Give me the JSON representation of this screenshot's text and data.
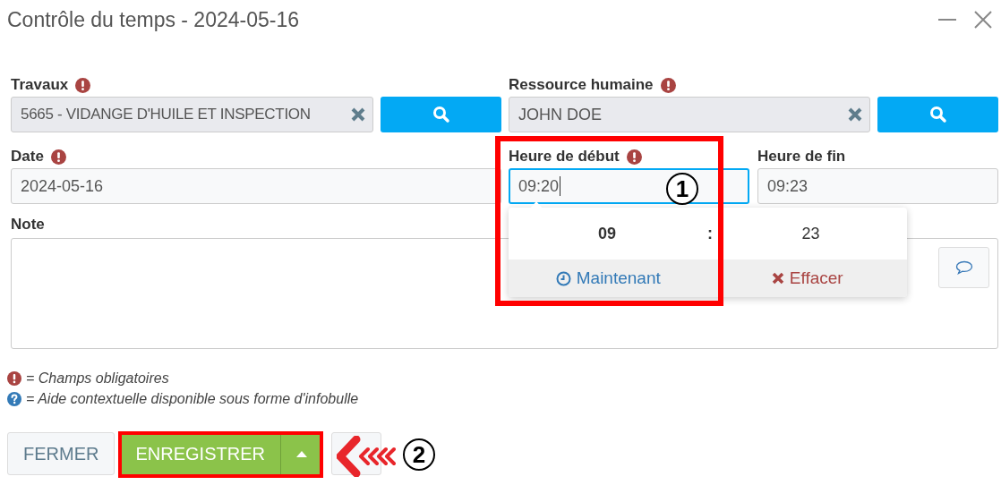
{
  "window": {
    "title": "Contrôle du temps - 2024-05-16"
  },
  "travaux": {
    "label": "Travaux",
    "required": true,
    "value": "5665 - VIDANGE D'HUILE ET INSPECTION"
  },
  "ressource": {
    "label": "Ressource humaine",
    "required": true,
    "value": "JOHN DOE"
  },
  "date": {
    "label": "Date",
    "required": true,
    "value": "2024-05-16"
  },
  "heure_debut": {
    "label": "Heure de début",
    "required": true,
    "value": "09:20",
    "focused": true
  },
  "heure_fin": {
    "label": "Heure de fin",
    "value": "09:23",
    "focused": false
  },
  "note": {
    "label": "Note"
  },
  "time_picker": {
    "hours": "09",
    "separator": ":",
    "minutes": "23",
    "now_button": "Maintenant",
    "clear_button": "Effacer"
  },
  "legend": [
    {
      "kind": "required",
      "text": "= Champs obligatoires"
    },
    {
      "kind": "help",
      "text": "= Aide contextuelle disponible sous forme d'infobulle"
    }
  ],
  "buttons": {
    "close": "FERMER",
    "save": "ENREGISTRER"
  },
  "annotations": [
    {
      "label": "1"
    },
    {
      "label": "2"
    }
  ]
}
